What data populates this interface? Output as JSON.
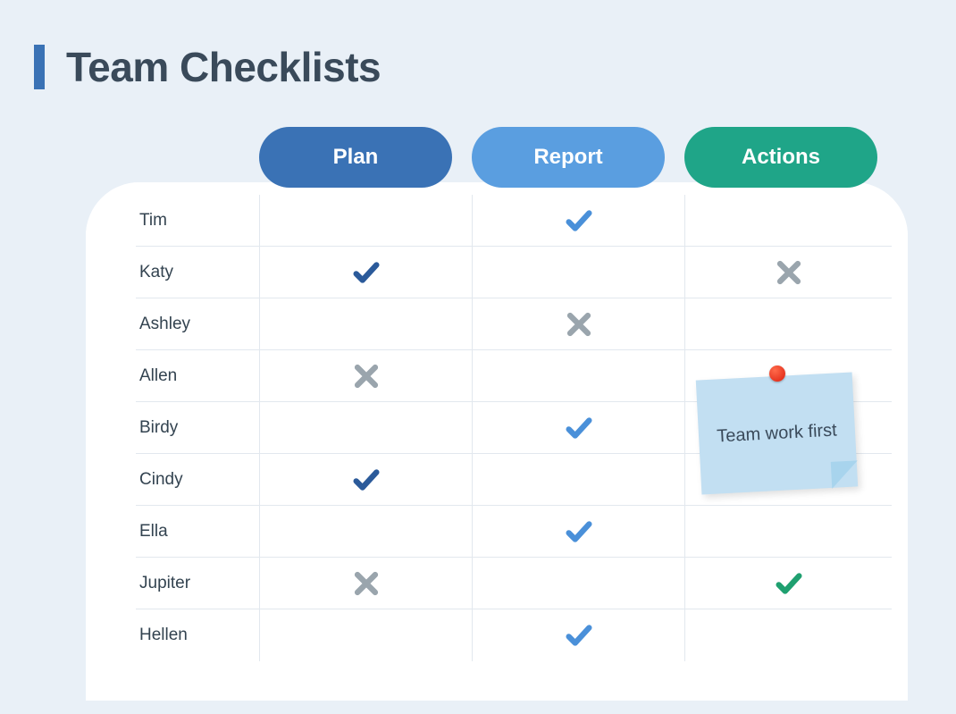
{
  "title": "Team Checklists",
  "columns": {
    "plan": "Plan",
    "report": "Report",
    "actions": "Actions"
  },
  "rows": [
    {
      "name": "Tim",
      "plan": "",
      "report": "check-blue",
      "actions": ""
    },
    {
      "name": "Katy",
      "plan": "check-dark",
      "report": "",
      "actions": "x-gray"
    },
    {
      "name": "Ashley",
      "plan": "",
      "report": "x-gray",
      "actions": ""
    },
    {
      "name": "Allen",
      "plan": "x-gray",
      "report": "",
      "actions": ""
    },
    {
      "name": "Birdy",
      "plan": "",
      "report": "check-blue",
      "actions": ""
    },
    {
      "name": "Cindy",
      "plan": "check-dark",
      "report": "",
      "actions": ""
    },
    {
      "name": "Ella",
      "plan": "",
      "report": "check-blue",
      "actions": ""
    },
    {
      "name": "Jupiter",
      "plan": "x-gray",
      "report": "",
      "actions": "check-green"
    },
    {
      "name": "Hellen",
      "plan": "",
      "report": "check-blue",
      "actions": ""
    }
  ],
  "sticky_note": "Team work first",
  "colors": {
    "check_dark": "#2b5a9a",
    "check_blue": "#4a90d9",
    "check_green": "#1fa070",
    "x_gray": "#9aa5ad"
  }
}
